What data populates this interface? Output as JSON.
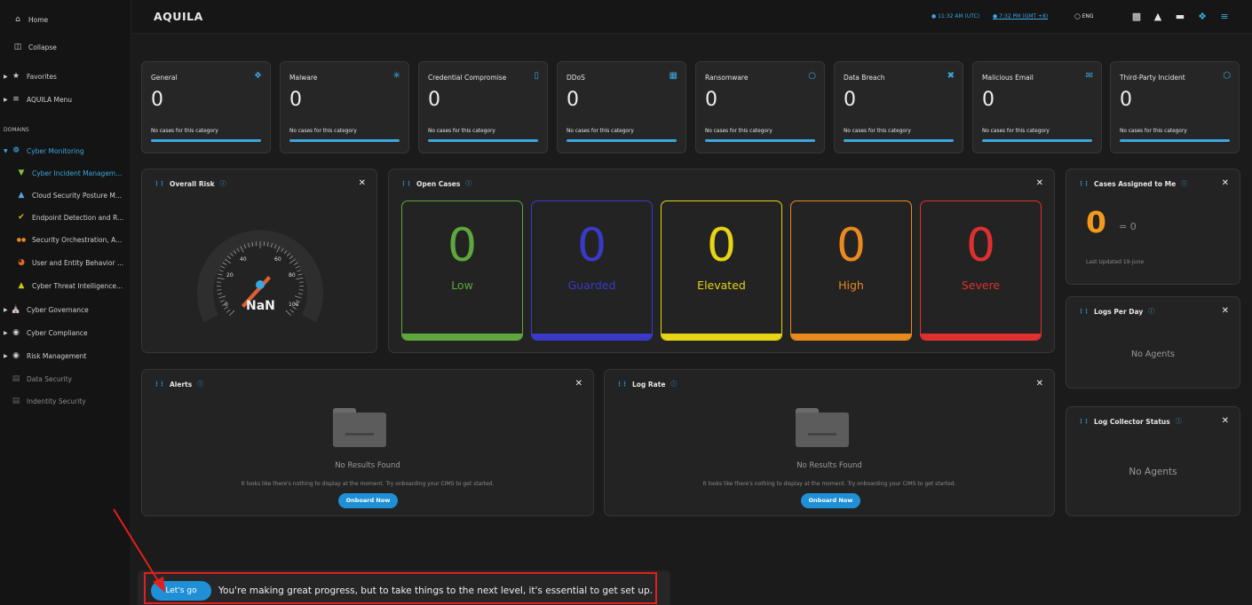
{
  "topbar": {
    "logo": "AQUILA",
    "utc_time": "11:32 AM (UTC)",
    "local_time": "7:32 PM (GMT +8)",
    "language": "ENG"
  },
  "sidebar": {
    "home": "Home",
    "collapse": "Collapse",
    "favorites": "Favorites",
    "menu": "AQUILA Menu",
    "domains_heading": "DOMAINS",
    "items": [
      {
        "label": "Cyber Monitoring",
        "icon": "globe-gear-icon"
      },
      {
        "label": "Cyber Incident Managem...",
        "icon": "filter-icon"
      },
      {
        "label": "Cloud Security Posture M...",
        "icon": "cloud-triangle-icon"
      },
      {
        "label": "Endpoint Detection and R...",
        "icon": "shield-check-icon"
      },
      {
        "label": "Security Orchestration, A...",
        "icon": "dots-icon"
      },
      {
        "label": "User and Entity Behavior ...",
        "icon": "pie-icon"
      },
      {
        "label": "Cyber Threat Intelligence...",
        "icon": "drop-icon"
      },
      {
        "label": "Cyber Governance",
        "icon": "bank-icon"
      },
      {
        "label": "Cyber Compliance",
        "icon": "shield-icon"
      },
      {
        "label": "Risk Management",
        "icon": "risk-icon"
      },
      {
        "label": "Data Security",
        "icon": "database-icon"
      },
      {
        "label": "Indentity Security",
        "icon": "id-icon"
      }
    ]
  },
  "categories": [
    {
      "title": "General",
      "value": "0",
      "status": "No cases for this category",
      "icon": "tag-icon"
    },
    {
      "title": "Malware",
      "value": "0",
      "status": "No cases for this category",
      "icon": "bug-icon"
    },
    {
      "title": "Credential Compromise",
      "value": "0",
      "status": "No cases for this category",
      "icon": "phone-icon"
    },
    {
      "title": "DDoS",
      "value": "0",
      "status": "No cases for this category",
      "icon": "calendar-icon"
    },
    {
      "title": "Ransomware",
      "value": "0",
      "status": "No cases for this category",
      "icon": "lock-user-icon"
    },
    {
      "title": "Data Breach",
      "value": "0",
      "status": "No cases for this category",
      "icon": "user-slash-icon"
    },
    {
      "title": "Malicious Email",
      "value": "0",
      "status": "No cases for this category",
      "icon": "email-stack-icon"
    },
    {
      "title": "Third-Party Incident",
      "value": "0",
      "status": "No cases for this category",
      "icon": "box-icon"
    }
  ],
  "overall_risk": {
    "title": "Overall Risk",
    "value": "NaN",
    "gauge_min": "0",
    "gauge_max": "100",
    "ticks": [
      "20",
      "40",
      "60",
      "80"
    ]
  },
  "open_cases": {
    "title": "Open Cases",
    "levels": [
      {
        "label": "Low",
        "value": "0",
        "color": "#5fa63c"
      },
      {
        "label": "Guarded",
        "value": "0",
        "color": "#3a3ac8"
      },
      {
        "label": "Elevated",
        "value": "0",
        "color": "#e7d414"
      },
      {
        "label": "High",
        "value": "0",
        "color": "#e98a1f"
      },
      {
        "label": "Severe",
        "value": "0",
        "color": "#e02f2f"
      }
    ]
  },
  "assigned": {
    "title": "Cases Assigned to Me",
    "value": "0",
    "eq": "= 0",
    "updated": "Last Updated 19-June"
  },
  "logs_per_day": {
    "title": "Logs Per Day",
    "empty": "No Agents"
  },
  "log_collector": {
    "title": "Log Collector Status",
    "empty": "No Agents"
  },
  "alerts": {
    "title": "Alerts",
    "empty_title": "No Results Found",
    "empty_desc": "It looks like there's nothing to display at the moment. Try onboarding your CIMS to get started.",
    "button": "Onboard Now"
  },
  "log_rate": {
    "title": "Log Rate",
    "empty_title": "No Results Found",
    "empty_desc": "It looks like there's nothing to display at the moment. Try onboarding your CIMS to get started.",
    "button": "Onboard Now"
  },
  "banner": {
    "button": "Let's go",
    "text": "You're making great progress, but to take things to the next level, it's essential to get set up."
  }
}
